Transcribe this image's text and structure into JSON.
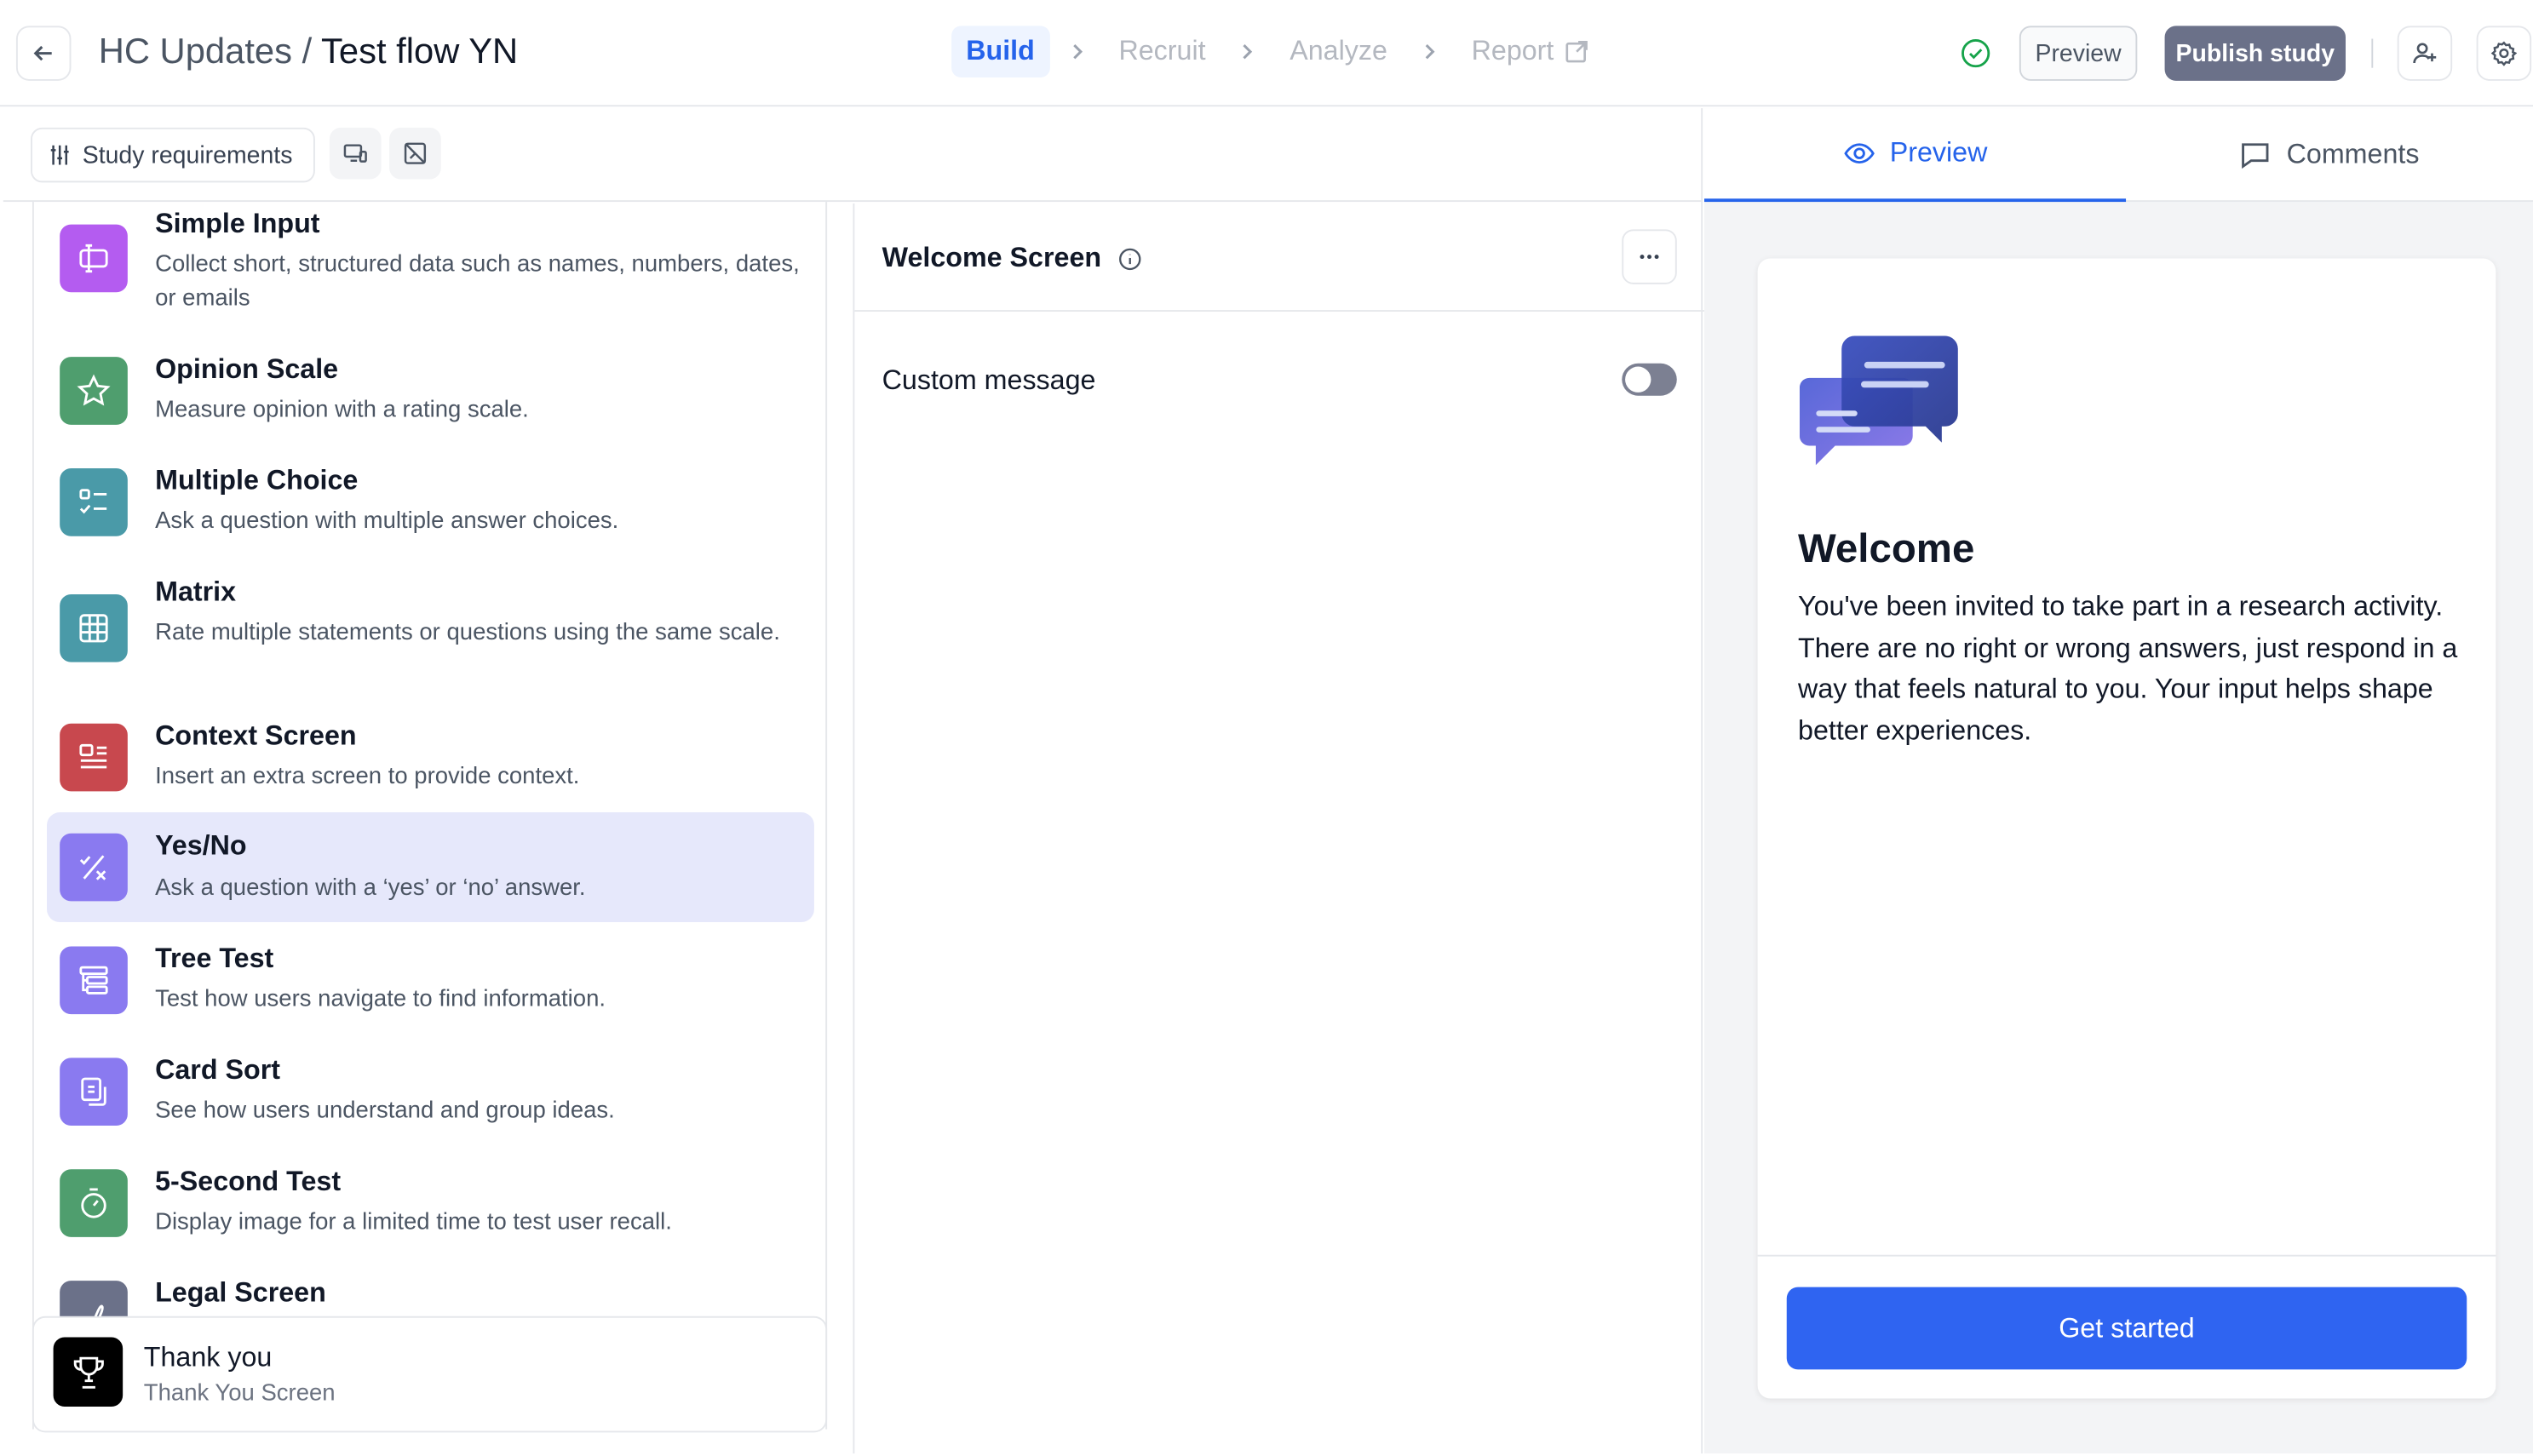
{
  "header": {
    "title_prefix": "HC Updates / ",
    "title_main": "Test flow YN",
    "steps": [
      {
        "label": "Build"
      },
      {
        "label": "Recruit"
      },
      {
        "label": "Analyze"
      },
      {
        "label": "Report"
      }
    ],
    "preview_label": "Preview",
    "publish_label": "Publish study"
  },
  "toolbar": {
    "requirements_label": "Study requirements"
  },
  "blocks": [
    {
      "title": "Simple Input",
      "desc": "Collect short, structured data such as names, numbers, dates, or emails",
      "color": "#b45cf0",
      "icon": "text-cursor-icon"
    },
    {
      "title": "Opinion Scale",
      "desc": "Measure opinion with a rating scale.",
      "color": "#4f9e6e",
      "icon": "star-icon"
    },
    {
      "title": "Multiple Choice",
      "desc": "Ask a question with multiple answer choices.",
      "color": "#4a9aa8",
      "icon": "list-check-icon"
    },
    {
      "title": "Matrix",
      "desc": "Rate multiple statements or questions using the same scale.",
      "color": "#4a9aa8",
      "icon": "grid-icon"
    },
    {
      "title": "Context Screen",
      "desc": "Insert an extra screen to provide context.",
      "color": "#c8484e",
      "icon": "context-icon"
    },
    {
      "title": "Yes/No",
      "desc": "Ask a question with a ‘yes’ or ‘no’ answer.",
      "color": "#8a7af0",
      "icon": "yes-no-icon"
    },
    {
      "title": "Tree Test",
      "desc": "Test how users navigate to find information.",
      "color": "#8a7af0",
      "icon": "tree-icon"
    },
    {
      "title": "Card Sort",
      "desc": "See how users understand and group ideas.",
      "color": "#8a7af0",
      "icon": "cards-icon"
    },
    {
      "title": "5-Second Test",
      "desc": "Display image for a limited time to test user recall.",
      "color": "#4f9e6e",
      "icon": "timer-icon"
    },
    {
      "title": "Legal Screen",
      "desc": "",
      "color": "#6b7189",
      "icon": "signature-icon"
    }
  ],
  "thankyou": {
    "title": "Thank you",
    "subtitle": "Thank You Screen"
  },
  "editor": {
    "title": "Welcome Screen",
    "custom_message_label": "Custom message",
    "custom_message_enabled": false
  },
  "preview_tabs": [
    {
      "label": "Preview"
    },
    {
      "label": "Comments"
    }
  ],
  "preview_card": {
    "title": "Welcome",
    "body": "You've been invited to take part in a research activity. There are no right or wrong answers, just respond in a way that feels natural to you. Your input helps shape better experiences.",
    "button": "Get started"
  }
}
